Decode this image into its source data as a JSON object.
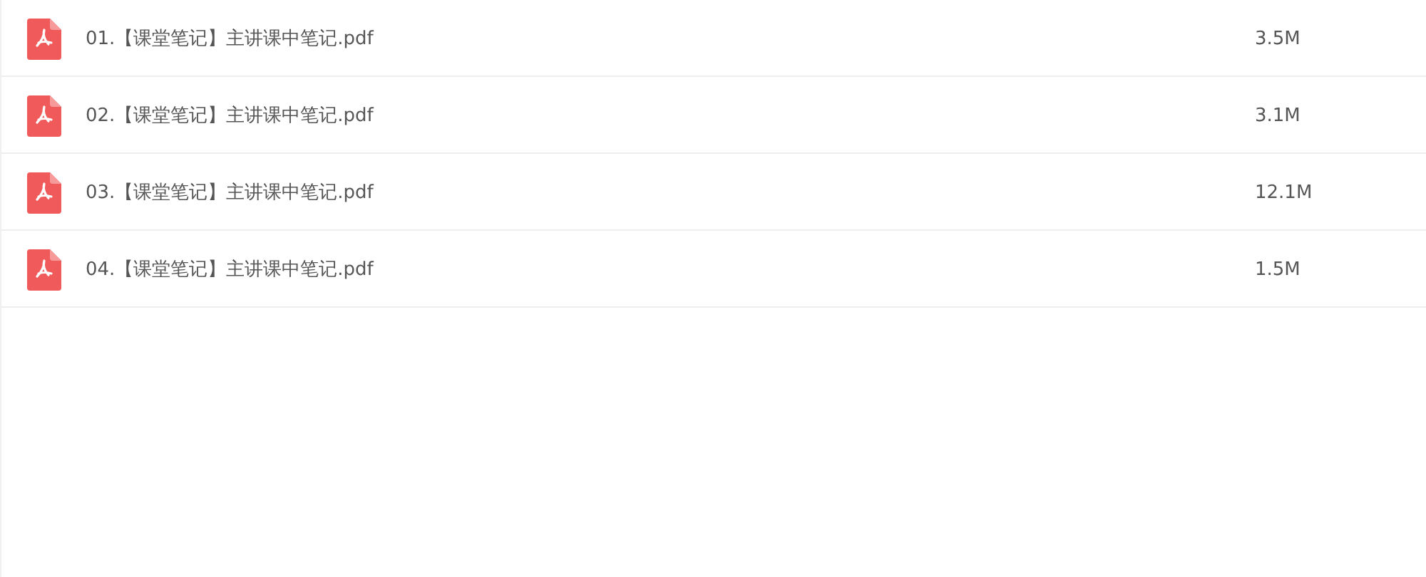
{
  "files": [
    {
      "name": "01.【课堂笔记】主讲课中笔记.pdf",
      "size": "3.5M"
    },
    {
      "name": "02.【课堂笔记】主讲课中笔记.pdf",
      "size": "3.1M"
    },
    {
      "name": "03.【课堂笔记】主讲课中笔记.pdf",
      "size": "12.1M"
    },
    {
      "name": "04.【课堂笔记】主讲课中笔记.pdf",
      "size": "1.5M"
    }
  ]
}
